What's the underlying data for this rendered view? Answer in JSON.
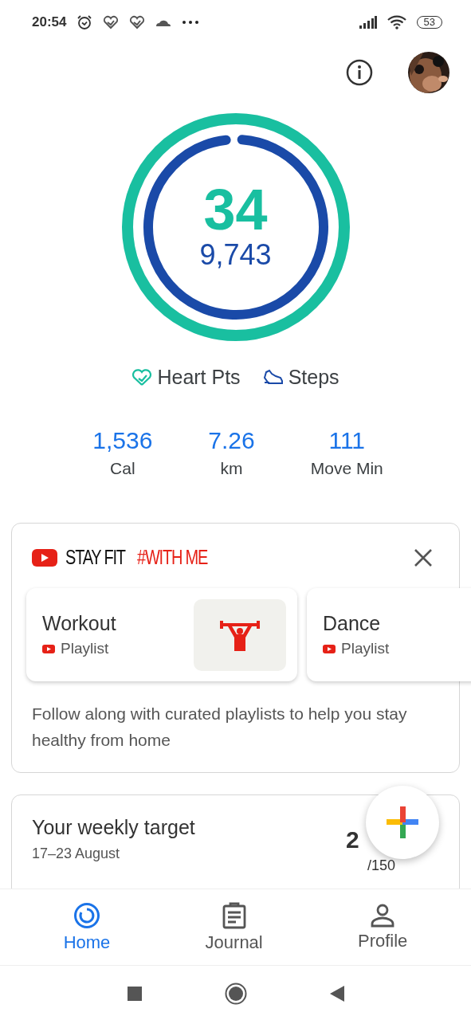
{
  "status_bar": {
    "time": "20:54",
    "battery": "53"
  },
  "rings": {
    "outer": {
      "value": "34",
      "level": 1
    },
    "inner": {
      "value": "9,743",
      "level": 0.97
    }
  },
  "legend": [
    {
      "label": "Heart Pts",
      "kind": "heart"
    },
    {
      "label": "Steps",
      "kind": "steps"
    }
  ],
  "stats": [
    {
      "value": "1,536",
      "label": "Cal"
    },
    {
      "value": "7.26",
      "label": "km"
    },
    {
      "value": "111",
      "label": "Move Min"
    }
  ],
  "promo": {
    "title": "STAY FIT",
    "hashtag": "#WITH ME",
    "playlists": [
      {
        "title": "Workout",
        "subtitle": "Playlist",
        "kind": "workout"
      },
      {
        "title": "Dance",
        "subtitle": "Playlist",
        "kind": "dance"
      }
    ],
    "description": "Follow along with curated playlists to help you stay healthy from home"
  },
  "weekly": {
    "title": "Your weekly target",
    "dates": "17–23 August",
    "value": "2",
    "target": "/150"
  },
  "nav": [
    {
      "label": "Home",
      "selected": true,
      "kind": "home"
    },
    {
      "label": "Journal",
      "selected": false,
      "kind": "journal"
    },
    {
      "label": "Profile",
      "selected": false,
      "kind": "profile"
    }
  ]
}
